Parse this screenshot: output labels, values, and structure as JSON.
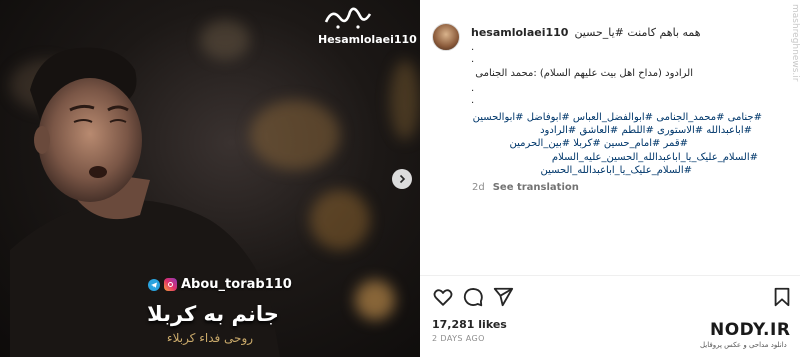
{
  "media": {
    "top_handle": "Hesamlolaei110",
    "bottom_handle": "Abou_torab110",
    "overlay_title": "جانم به کربلا",
    "overlay_subtitle": "روحی فداء کربلاء"
  },
  "post": {
    "username": "hesamlolaei110",
    "lines": [
      {
        "id": "first",
        "text": "همه باهم کامنت #یا_حسین"
      },
      {
        "id": "credit",
        "text": "الرادود (مداح اهل بیت علیهم السلام) :محمد الجنامی"
      },
      {
        "id": "tags1",
        "text": "#جنامی #محمد_الجنامی #ابوالفضل_العباس #ابوفاضل #ابوالحسین"
      },
      {
        "id": "tags2",
        "text": "#اباعبدالله #الاستوری #اللطم #العاشق #الرادود"
      },
      {
        "id": "tags3",
        "text": "#قمر #امام_حسین #کربلا #بین_الحرمین"
      },
      {
        "id": "tags4",
        "text": "#السلام_علیک_یا_اباعبدالله_الحسین_علیه_السلام"
      },
      {
        "id": "tags5",
        "text": "#السلام_علیک_یا_اباعبدالله_الحسین"
      }
    ],
    "dots": [
      ".",
      ".",
      ".",
      "."
    ],
    "time_ago": "2d",
    "see_translation": "See translation",
    "likes": "17,281 likes",
    "date": "2 DAYS AGO"
  },
  "watermarks": {
    "site": "NODY.IR",
    "site_sub": "دانلود مداحی و عکس پروفایل",
    "side_mark": "mashreghnews.ir"
  },
  "icons": {
    "like": "heart-icon",
    "comment": "comment-icon",
    "share": "send-icon",
    "save": "bookmark-icon",
    "next": "chevron-right-icon"
  },
  "colors": {
    "hashtag": "#00376b",
    "muted": "#8e8e8e",
    "text": "#262626"
  }
}
